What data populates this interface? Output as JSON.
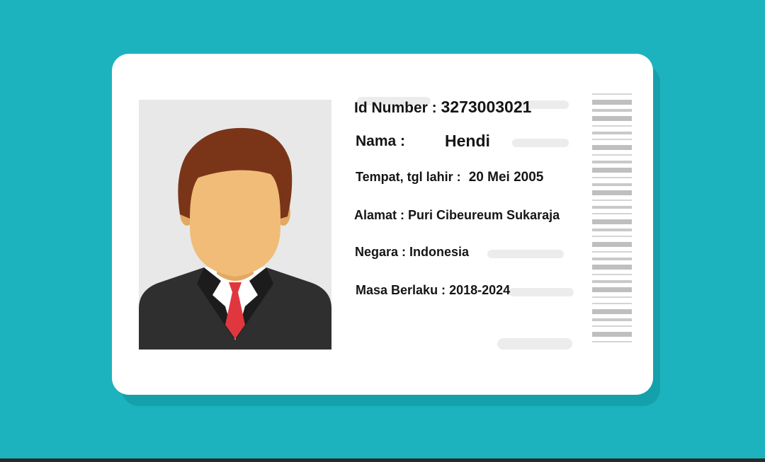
{
  "card": {
    "fields": [
      {
        "label": "Id Number :",
        "value": "3273003021"
      },
      {
        "label": "Nama :",
        "value": "Hendi"
      },
      {
        "label": "Tempat, tgl lahir :",
        "value": "20 Mei 2005"
      },
      {
        "label": "Alamat :",
        "value": "Puri Cibeureum Sukaraja"
      },
      {
        "label": "Negara :",
        "value": "Indonesia"
      },
      {
        "label": "Masa Berlaku :",
        "value": "2018-2024"
      }
    ],
    "photo_icon": "person-avatar-icon",
    "barcode_icon": "barcode-stripes-icon"
  },
  "colors": {
    "background": "#1cb3be",
    "card": "#ffffff",
    "photo_bg": "#e8e8e8",
    "hair": "#7a3519",
    "skin": "#f1bc78",
    "suit": "#2f2f2f",
    "tie": "#e0373f"
  }
}
